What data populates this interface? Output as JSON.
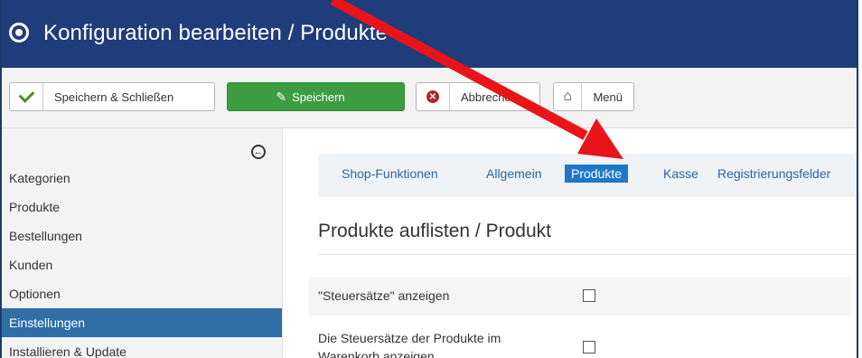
{
  "header": {
    "title": "Konfiguration bearbeiten / Produkte"
  },
  "toolbar": {
    "save_close_label": "Speichern & Schließen",
    "save_label": "Speichern",
    "cancel_label": "Abbrechen",
    "menu_label": "Menü"
  },
  "sidebar": {
    "items": [
      "Kategorien",
      "Produkte",
      "Bestellungen",
      "Kunden",
      "Optionen",
      "Einstellungen",
      "Installieren & Update"
    ],
    "active": "Einstellungen"
  },
  "tabs": [
    "Shop-Funktionen",
    "Allgemein",
    "Produkte",
    "Kasse",
    "Registrierungsfelder"
  ],
  "active_tab": "Produkte",
  "section": {
    "heading": "Produkte auflisten / Produkt",
    "option1_label": "\"Steuersätze\" anzeigen",
    "option2_label_line1": "Die Steuersätze der Produkte im",
    "option2_label_line2": "Warenkorb anzeigen"
  },
  "colors": {
    "header": "#1f3d7a",
    "save_button": "#3d9c3f",
    "active_nav": "#2f6fa6",
    "active_tab": "#1f77c8",
    "annotation_arrow": "#e8141a"
  }
}
